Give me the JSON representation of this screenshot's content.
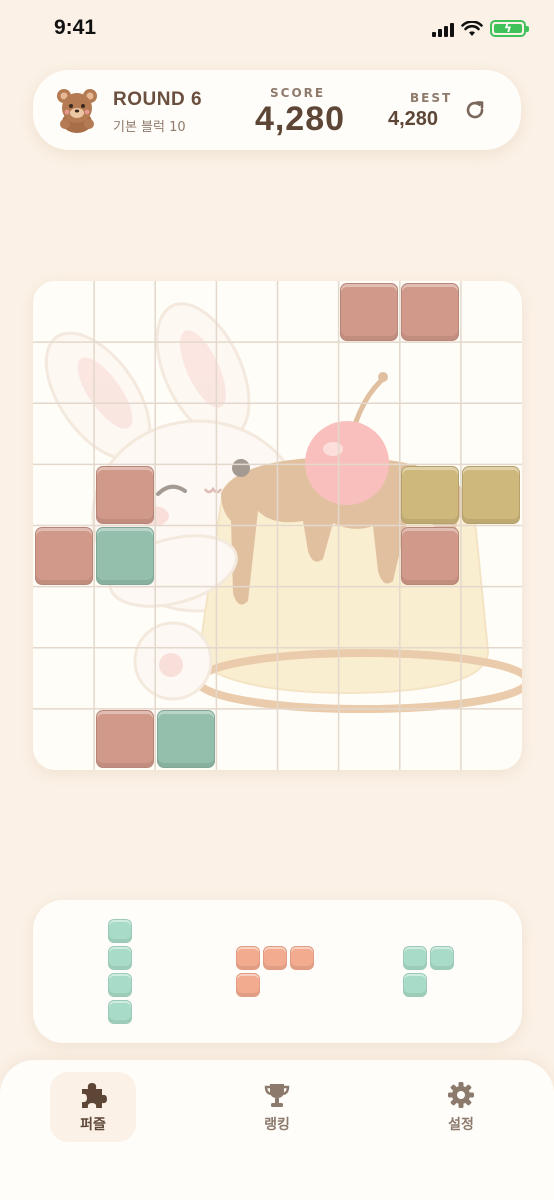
{
  "status_bar": {
    "time": "9:41"
  },
  "header": {
    "round_label": "ROUND 6",
    "round_sub": "기본 블럭 10",
    "score_label": "SCORE",
    "score": "4,280",
    "best_label": "BEST",
    "best": "4,280"
  },
  "colors": {
    "rose": "#d1998a",
    "sage": "#94bfad",
    "mustard": "#cfb87c",
    "mint": "#a9dcc8",
    "peach": "#f3ab8f",
    "nav_active": "#5e4636",
    "nav_inactive": "#8c7a6d"
  },
  "board": {
    "rows": 8,
    "cols": 8,
    "cells": [
      {
        "row": 0,
        "col": 5,
        "color": "rose"
      },
      {
        "row": 0,
        "col": 6,
        "color": "rose"
      },
      {
        "row": 3,
        "col": 1,
        "color": "rose"
      },
      {
        "row": 3,
        "col": 6,
        "color": "mustard"
      },
      {
        "row": 3,
        "col": 7,
        "color": "mustard"
      },
      {
        "row": 4,
        "col": 0,
        "color": "rose"
      },
      {
        "row": 4,
        "col": 1,
        "color": "sage"
      },
      {
        "row": 4,
        "col": 6,
        "color": "rose"
      },
      {
        "row": 7,
        "col": 1,
        "color": "rose"
      },
      {
        "row": 7,
        "col": 2,
        "color": "sage"
      }
    ],
    "background_art": "bunny-and-pudding-illustration"
  },
  "tray": {
    "pieces": [
      {
        "name": "piece-i-vertical",
        "color": "mint",
        "cells": [
          [
            0,
            0
          ],
          [
            1,
            0
          ],
          [
            2,
            0
          ],
          [
            3,
            0
          ]
        ]
      },
      {
        "name": "piece-l",
        "color": "peach",
        "cells": [
          [
            0,
            0
          ],
          [
            0,
            1
          ],
          [
            0,
            2
          ],
          [
            1,
            0
          ]
        ]
      },
      {
        "name": "piece-corner",
        "color": "mint",
        "cells": [
          [
            0,
            0
          ],
          [
            0,
            1
          ],
          [
            1,
            0
          ]
        ]
      }
    ]
  },
  "nav": {
    "items": [
      {
        "label": "퍼즐",
        "icon": "puzzle-icon",
        "active": true
      },
      {
        "label": "랭킹",
        "icon": "trophy-icon",
        "active": false
      },
      {
        "label": "설정",
        "icon": "gear-icon",
        "active": false
      }
    ]
  }
}
